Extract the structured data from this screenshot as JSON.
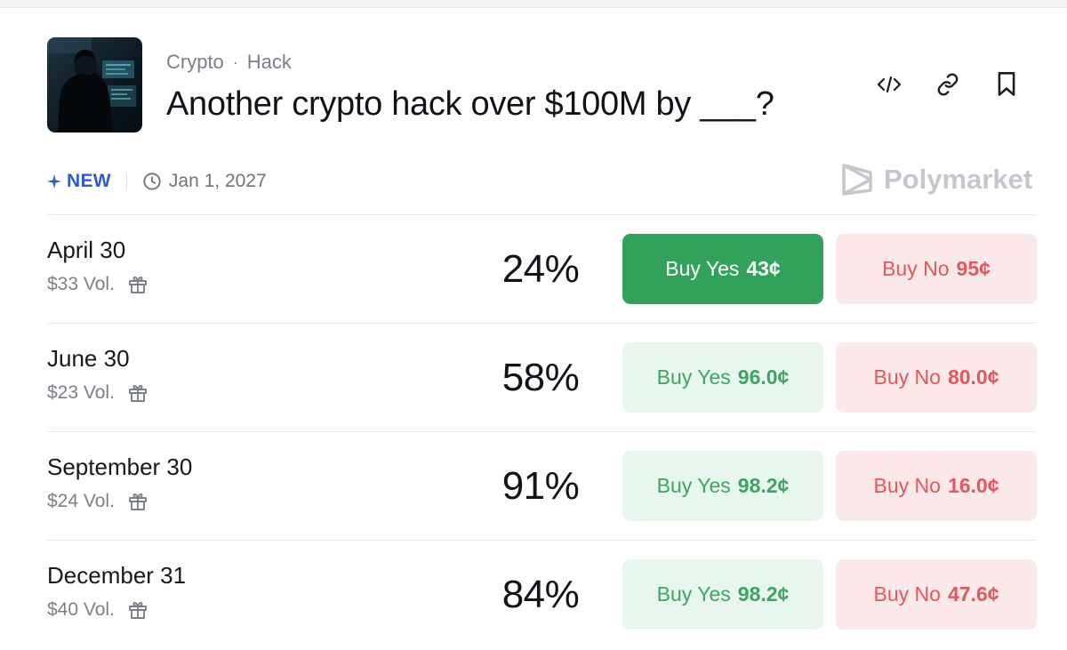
{
  "header": {
    "breadcrumb": [
      "Crypto",
      "Hack"
    ],
    "title": "Another crypto hack over $100M by ___?"
  },
  "meta": {
    "new_badge": "NEW",
    "end_date": "Jan 1, 2027",
    "brand": "Polymarket"
  },
  "actions": [
    "embed-icon",
    "link-icon",
    "bookmark-icon"
  ],
  "colors": {
    "yes_active_bg": "#31a25a",
    "yes_bg": "#e8f7ee",
    "yes_text": "#3fa364",
    "no_bg": "#fbe9ea",
    "no_text": "#e0585f",
    "new_badge": "#2e5bce"
  },
  "outcomes": [
    {
      "name": "April 30",
      "volume": "$33 Vol.",
      "probability": "24%",
      "yes_label": "Buy Yes",
      "yes_price": "43¢",
      "no_label": "Buy No",
      "no_price": "95¢",
      "selected": true
    },
    {
      "name": "June 30",
      "volume": "$23 Vol.",
      "probability": "58%",
      "yes_label": "Buy Yes",
      "yes_price": "96.0¢",
      "no_label": "Buy No",
      "no_price": "80.0¢",
      "selected": false
    },
    {
      "name": "September 30",
      "volume": "$24 Vol.",
      "probability": "91%",
      "yes_label": "Buy Yes",
      "yes_price": "98.2¢",
      "no_label": "Buy No",
      "no_price": "16.0¢",
      "selected": false
    },
    {
      "name": "December 31",
      "volume": "$40 Vol.",
      "probability": "84%",
      "yes_label": "Buy Yes",
      "yes_price": "98.2¢",
      "no_label": "Buy No",
      "no_price": "47.6¢",
      "selected": false
    }
  ]
}
